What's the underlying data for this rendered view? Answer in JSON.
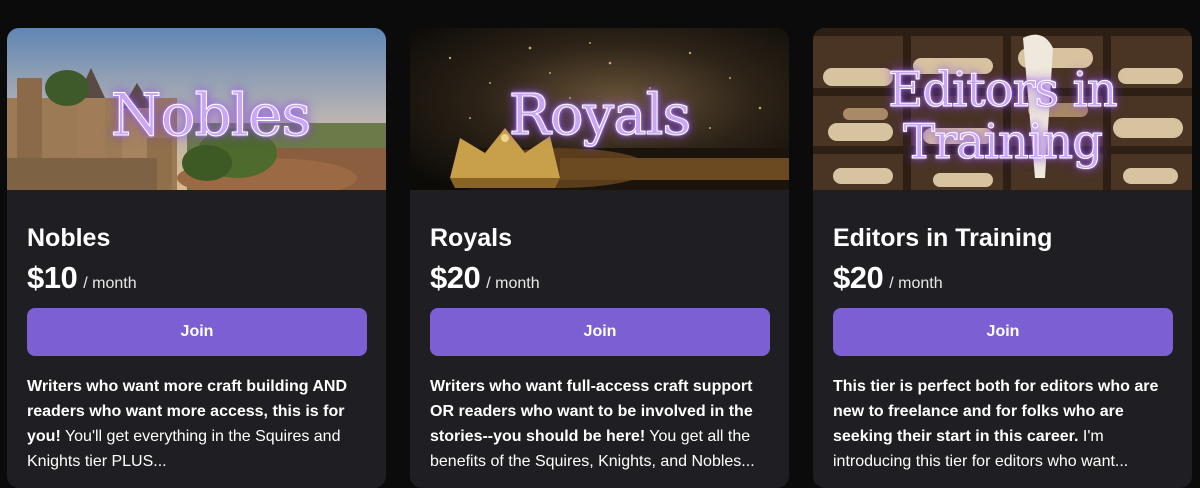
{
  "tiers": [
    {
      "banner_text": "Nobles",
      "name": "Nobles",
      "price": "$10",
      "period": "/ month",
      "join_label": "Join",
      "desc_bold": "Writers who want more craft building AND readers who want more access, this is for you!",
      "desc_rest": " You'll get everything in the Squires and Knights tier PLUS..."
    },
    {
      "banner_text": "Royals",
      "name": "Royals",
      "price": "$20",
      "period": "/ month",
      "join_label": "Join",
      "desc_bold": "Writers who want full-access craft support OR readers who want to be involved in the stories--you should be here!",
      "desc_rest": " You get all the benefits of the Squires, Knights, and Nobles..."
    },
    {
      "banner_text_line1": "Editors in",
      "banner_text_line2": "Training",
      "name": "Editors in Training",
      "price": "$20",
      "period": "/ month",
      "join_label": "Join",
      "desc_bold": "This tier is perfect both for editors who are new to freelance and for folks who are seeking their start in this career.",
      "desc_rest": " I'm introducing this tier for editors who want..."
    }
  ],
  "colors": {
    "page_bg": "#0b0b0c",
    "card_bg": "#1f1f23",
    "join_button": "#7b5fd3",
    "banner_text_glow": "#a46cff"
  }
}
